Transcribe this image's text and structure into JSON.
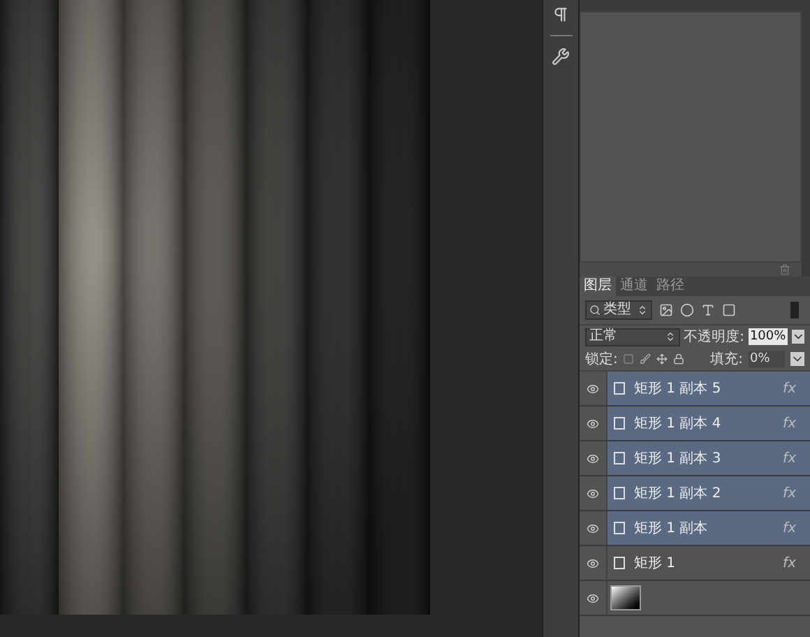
{
  "layers_panel": {
    "tabs": [
      {
        "label": "图层",
        "selected": true
      },
      {
        "label": "通道",
        "selected": false
      },
      {
        "label": "路径",
        "selected": false
      }
    ],
    "filter": {
      "value": "类型",
      "on": true
    },
    "blend_mode": {
      "value": "正常"
    },
    "opacity": {
      "label": "不透明度:",
      "value": "100%"
    },
    "lock": {
      "label": "锁定:"
    },
    "fill": {
      "label": "填充:",
      "value": "0%"
    },
    "layers": [
      {
        "kind": "shape",
        "name": "矩形 1 副本 5",
        "selected": true,
        "fx": "fx"
      },
      {
        "kind": "shape",
        "name": "矩形 1 副本 4",
        "selected": true,
        "fx": "fx"
      },
      {
        "kind": "shape",
        "name": "矩形 1 副本 3",
        "selected": true,
        "fx": "fx"
      },
      {
        "kind": "shape",
        "name": "矩形 1 副本 2",
        "selected": true,
        "fx": "fx"
      },
      {
        "kind": "shape",
        "name": "矩形 1 副本",
        "selected": true,
        "fx": "fx"
      },
      {
        "kind": "shape",
        "name": "矩形 1",
        "selected": false,
        "fx": "fx"
      },
      {
        "kind": "gradient",
        "selected": false
      }
    ]
  }
}
